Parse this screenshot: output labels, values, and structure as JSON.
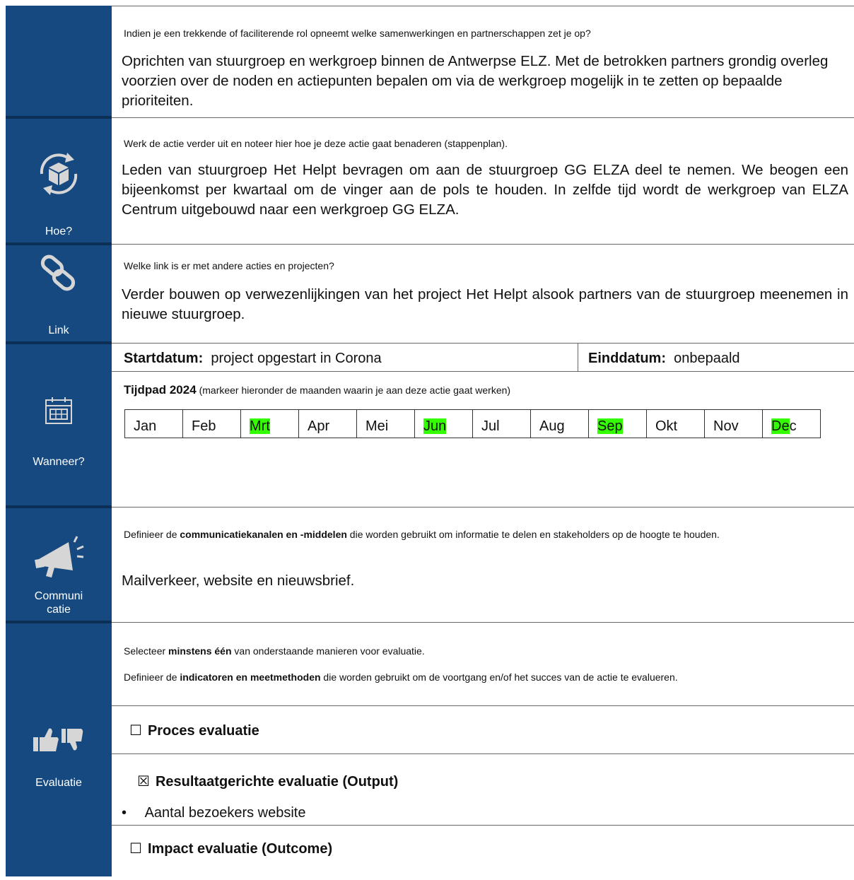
{
  "rows": {
    "samenwerking": {
      "question": "Indien je een trekkende of faciliterende rol opneemt welke samenwerkingen en partnerschappen zet je op?",
      "answer": "Oprichten van stuurgroep en werkgroep binnen de Antwerpse ELZ. Met de betrokken partners grondig overleg voorzien over de noden en actiepunten bepalen om via de werkgroep mogelijk in te zetten op bepaalde prioriteiten."
    },
    "hoe": {
      "label": "Hoe?",
      "question": "Werk de actie verder uit en noteer hier hoe je deze actie gaat benaderen (stappenplan).",
      "answer": "Leden van stuurgroep Het Helpt bevragen om aan de stuurgroep GG ELZA deel te nemen.  We beogen een bijeenkomst per kwartaal om de vinger aan de pols te houden.  In zelfde tijd wordt de werkgroep van ELZA Centrum uitgebouwd naar een werkgroep GG ELZA."
    },
    "link": {
      "label": "Link",
      "question": "Welke link is er met andere acties en projecten?",
      "answer": "Verder bouwen op verwezenlijkingen van het project Het Helpt alsook partners van de stuurgroep meenemen in nieuwe stuurgroep."
    },
    "wanneer": {
      "label": "Wanneer?",
      "start_label": "Startdatum:",
      "start_value": "project opgestart in Corona",
      "end_label": "Einddatum:",
      "end_value": "onbepaald",
      "tijdpad_label": "Tijdpad 2024",
      "tijdpad_note": "(markeer hieronder de maanden waarin je aan deze actie gaat werken)",
      "months": [
        "Jan",
        "Feb",
        "Mrt",
        "Apr",
        "Mei",
        "Jun",
        "Jul",
        "Aug",
        "Sep",
        "Okt",
        "Nov",
        "Dec"
      ],
      "highlighted": [
        "Mrt",
        "Jun",
        "Sep",
        "De"
      ],
      "highlight_color": "#33ff00"
    },
    "communicatie": {
      "label": "Communicatie",
      "question_pre": "Definieer de ",
      "question_bold": "communicatiekanalen en -middelen",
      "question_post": " die worden gebruikt om informatie te delen en stakeholders op de hoogte te houden.",
      "answer": "Mailverkeer, website en nieuwsbrief."
    },
    "evaluatie": {
      "label": "Evaluatie",
      "q1_pre": "Selecteer ",
      "q1_bold": "minstens één",
      "q1_post": " van onderstaande manieren voor evaluatie.",
      "q2_pre": "Definieer de ",
      "q2_bold": "indicatoren en meetmethoden",
      "q2_post": " die worden gebruikt om de voortgang en/of het succes van de actie te evalueren.",
      "options": [
        {
          "box": "☐",
          "label": "Proces evaluatie"
        },
        {
          "box": "☒",
          "label": "Resultaatgerichte evaluatie (Output)"
        },
        {
          "box": "☐",
          "label": "Impact evaluatie (Outcome)"
        }
      ],
      "bullet": "Aantal bezoekers website"
    }
  },
  "colors": {
    "sidebar": "#15497f",
    "icon": "#d6d6d6"
  }
}
